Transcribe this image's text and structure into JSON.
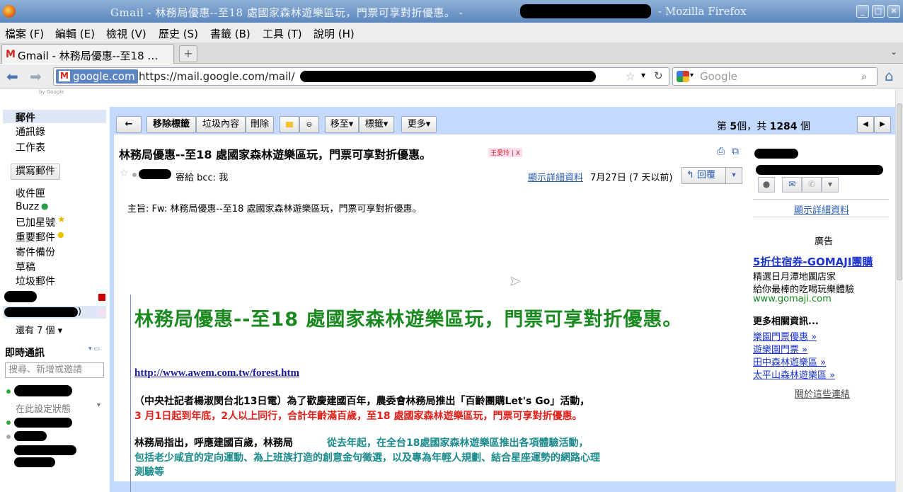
{
  "window": {
    "title": "Gmail - 林務局優惠--至18 處國家森林遊樂區玩，門票可享對折優惠。 -",
    "title_suffix": "- Mozilla Firefox"
  },
  "menu": [
    "檔案 (F)",
    "編輯 (E)",
    "檢視 (V)",
    "歷史 (S)",
    "書籤 (B)",
    "工具 (T)",
    "說明 (H)"
  ],
  "tab": {
    "label": "Gmail - 林務局優惠--至18 …",
    "newtab": "+"
  },
  "nav": {
    "identity": "google.com",
    "url": "https://mail.google.com/mail/",
    "search_placeholder": "Google"
  },
  "gmail": {
    "logo_sub": "by Google",
    "sidebar": {
      "mail": "郵件",
      "contacts": "通訊錄",
      "tasks": "工作表",
      "compose": "撰寫郵件",
      "folders": [
        "收件匣",
        "Buzz",
        "已加星號",
        "重要郵件",
        "寄件備份",
        "草稿",
        "垃圾郵件"
      ],
      "more": "還有 7 個 ▾",
      "chat_title": "即時通訊",
      "chat_search": "搜尋、新增或邀請",
      "status": "在此設定狀態"
    },
    "toolbar": {
      "back": "←",
      "remove_label": "移除標籤",
      "spam": "垃圾內容",
      "delete": "刪除",
      "move_to": "移至▾",
      "labels": "標籤▾",
      "more": "更多▾",
      "pager_prefix": "第",
      "pager_num": "5",
      "pager_mid": "個，共",
      "pager_total": "1284",
      "pager_suffix": "個"
    },
    "message": {
      "subject": "林務局優惠--至18 處國家森林遊樂區玩，門票可享對折優惠。",
      "label": "王愛玲 | X",
      "to_line": "寄給 bcc: 我",
      "show_details": "顯示詳細資料",
      "date": "7月27日 (7 天以前)",
      "reply": "回覆",
      "subject_line": "主旨:  Fw: 林務局優惠--至18 處國家森林遊樂區玩，門票可享對折優惠。",
      "headline": "林務局優惠--至18 處國家森林遊樂區玩，門票可享對折優惠。",
      "source_link": "http://www.awem.com.tw/forest.htm",
      "para1_black": "（中央社記者楊淑閔台北13日電）為了歡慶建國百年，農委會林務局推出「百齡團購Let's Go」活動，",
      "para1_red": "3 月1日起到年底，2人以上同行，合計年齡滿百歲，至18 處國家森林遊樂區玩，門票可享對折優惠。",
      "para2_black": "林務局指出，呼應建國百歲，林務局",
      "para2_teal": "從去年起，在全台18處國家森林遊樂區推出各項體驗活動，",
      "para2_teal2": "包括老少咸宜的定向運動、為上班族打造的創意金句徵選，以及專為年輕人規劃、結合星座運勢的網路心理",
      "para2_teal3": "測驗等"
    },
    "right": {
      "show_details": "顯示詳細資料",
      "ads_title": "廣告",
      "ad_title": "5折住宿券-GOMAJI團購",
      "ad_line1": "精選日月潭地圖店家",
      "ad_line2": "給你最棒的吃喝玩樂體驗",
      "ad_url": "www.gomaji.com",
      "related_title": "更多相關資訊...",
      "related": [
        "樂園門票優惠 »",
        "遊樂園門票 »",
        "田中森林遊樂區 »",
        "太平山森林遊樂區 »"
      ],
      "about_links": "關於這些連結"
    }
  },
  "colors": {
    "headline": "#1a8a20",
    "red_text": "#e0201a",
    "teal_text": "#1a8a8a",
    "gmail_blue": "#c3d9ff"
  }
}
